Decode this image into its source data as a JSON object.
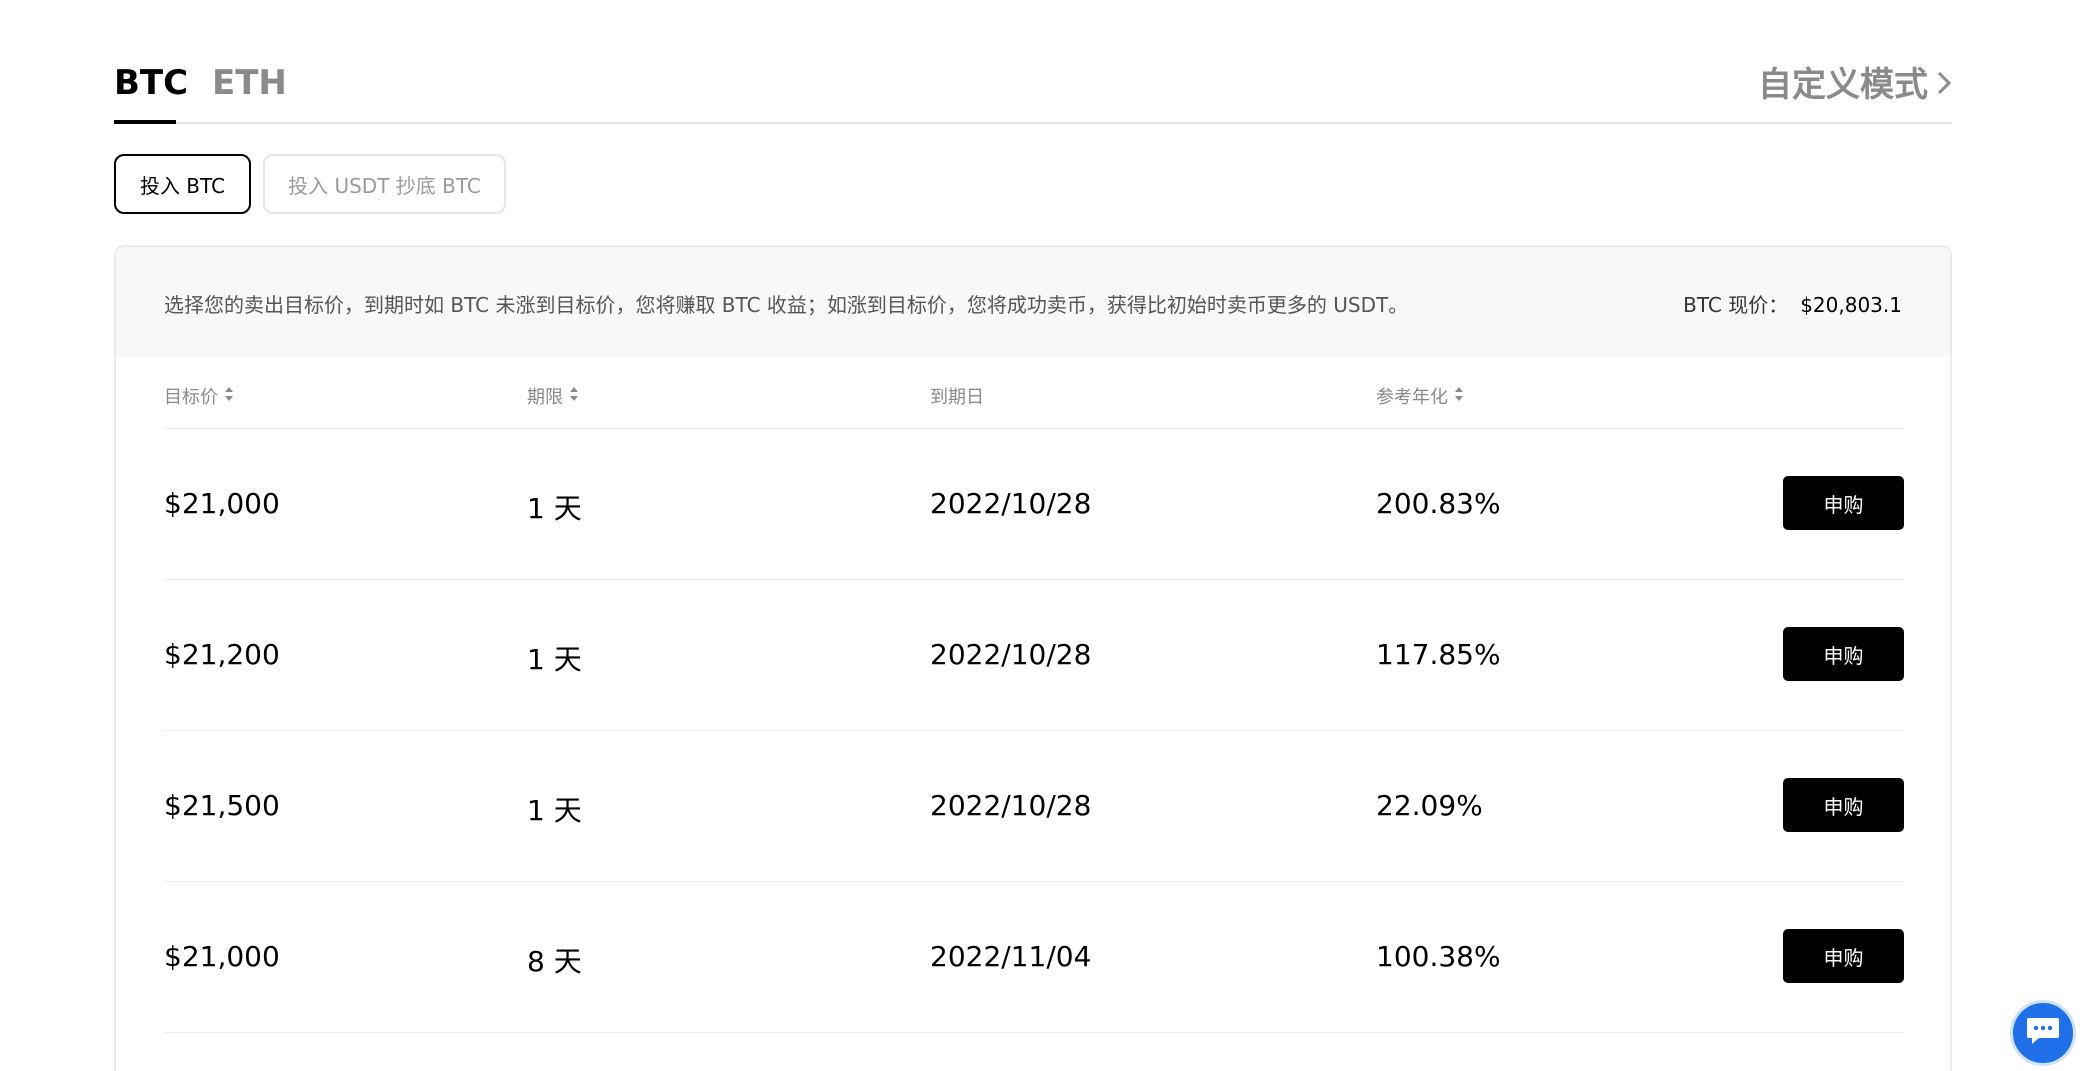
{
  "tabs": [
    {
      "label": "BTC",
      "active": true
    },
    {
      "label": "ETH",
      "active": false
    }
  ],
  "custom_mode_label": "自定义模式",
  "modes": [
    {
      "label": "投入 BTC",
      "active": true
    },
    {
      "label": "投入 USDT 抄底 BTC",
      "active": false
    }
  ],
  "card": {
    "description": "选择您的卖出目标价，到期时如 BTC 未涨到目标价，您将赚取 BTC 收益；如涨到目标价，您将成功卖币，获得比初始时卖币更多的 USDT。",
    "price_label": "BTC 现价：",
    "price_value": "$20,803.1"
  },
  "table": {
    "headers": [
      "目标价",
      "期限",
      "到期日",
      "参考年化"
    ],
    "buy_label": "申购",
    "rows": [
      {
        "target": "$21,000",
        "term": "1 天",
        "expiry": "2022/10/28",
        "apy": "200.83%"
      },
      {
        "target": "$21,200",
        "term": "1 天",
        "expiry": "2022/10/28",
        "apy": "117.85%"
      },
      {
        "target": "$21,500",
        "term": "1 天",
        "expiry": "2022/10/28",
        "apy": "22.09%"
      },
      {
        "target": "$21,000",
        "term": "8 天",
        "expiry": "2022/11/04",
        "apy": "100.38%"
      }
    ]
  },
  "colors": {
    "accent": "#000000",
    "muted": "#8a8a8a",
    "chat": "#1f6fe8"
  },
  "icons": {
    "custom_mode": "chevron-right-icon",
    "sort": "sort-icon",
    "chat": "chat-icon"
  }
}
